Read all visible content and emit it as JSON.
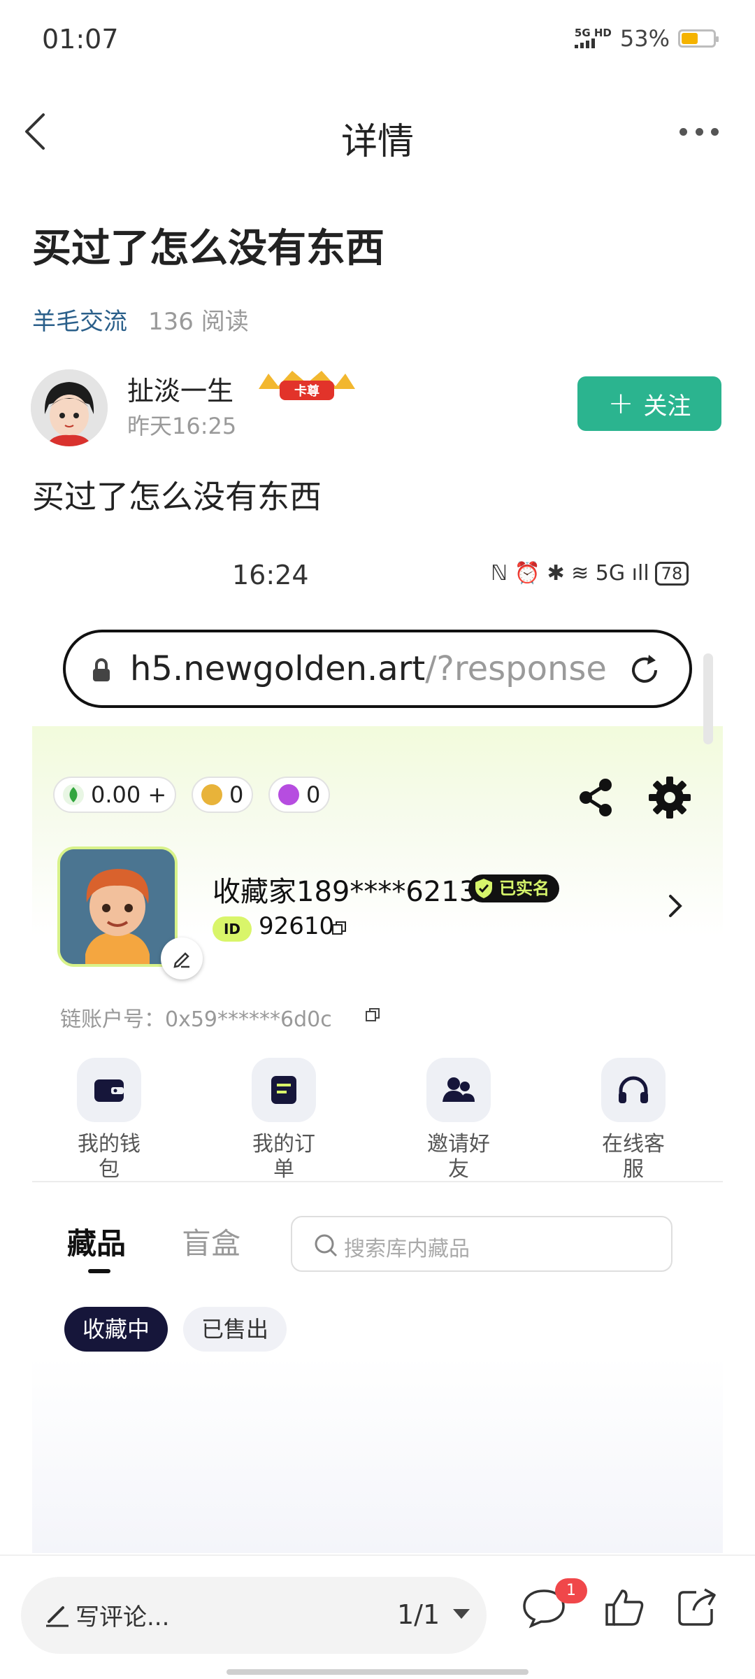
{
  "status_bar": {
    "time": "01:07",
    "network_top": "5G HD",
    "network_bottom": "",
    "battery_percent": "53%",
    "battery_level": 0.53
  },
  "nav": {
    "title": "详情"
  },
  "post": {
    "title": "买过了怎么没有东西",
    "topic": "羊毛交流",
    "reads": "136 阅读",
    "author_name": "扯淡一生",
    "author_badge": "卡尊",
    "post_time": "昨天16:25",
    "follow_label": "关注",
    "body": "买过了怎么没有东西"
  },
  "embedded": {
    "status_time": "16:24",
    "status_icons": "ℕ ⏰ ✱ ≋ 5G ıll",
    "battery": "78",
    "url_main": "h5.newgolden.art",
    "url_rest": "/?response=",
    "balances": [
      {
        "value": "0.00 +",
        "icon": "leaf-coin-icon",
        "color": "#33a63f"
      },
      {
        "value": "0",
        "icon": "gold-coin-icon",
        "color": "#e8b33a"
      },
      {
        "value": "0",
        "icon": "gem-icon",
        "color": "#b64de0"
      }
    ],
    "username": "收藏家189****6213",
    "verified_label": "已实名",
    "id_label": "ID",
    "id_value": "92610",
    "chain_account": "链账户号：0x59******6d0c",
    "menu": [
      {
        "label": "我的钱包",
        "icon": "wallet-icon"
      },
      {
        "label": "我的订单",
        "icon": "order-icon"
      },
      {
        "label": "邀请好友",
        "icon": "friends-icon"
      },
      {
        "label": "在线客服",
        "icon": "headset-icon"
      }
    ],
    "tabs": [
      {
        "label": "藏品",
        "active": true
      },
      {
        "label": "盲盒",
        "active": false
      }
    ],
    "search_placeholder": "搜索库内藏品",
    "chips": [
      {
        "label": "收藏中",
        "active": true
      },
      {
        "label": "已售出",
        "active": false
      }
    ]
  },
  "bottom_bar": {
    "comment_placeholder": "写评论...",
    "page_indicator": "1/1",
    "comment_count": "1"
  },
  "colors": {
    "accent_green": "#2bb48f",
    "topic_blue": "#2a5f8a",
    "badge_red": "#f0474a",
    "lime": "#d9f56a",
    "dark_navy": "#16163a"
  }
}
